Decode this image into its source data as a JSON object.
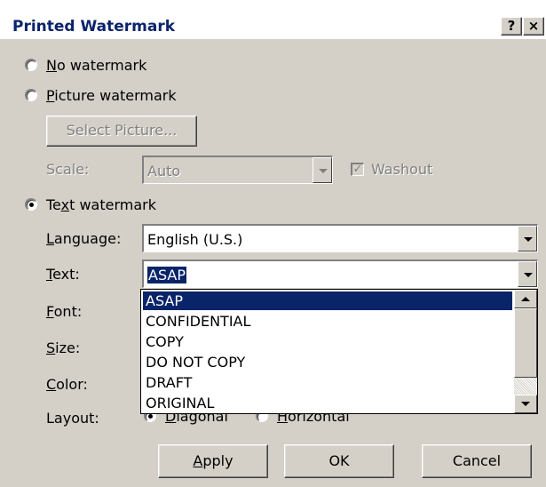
{
  "window": {
    "title": "Printed Watermark",
    "help_label": "?",
    "close_label": "×"
  },
  "options": {
    "no_watermark": {
      "label": "No watermark",
      "selected": false
    },
    "picture_watermark": {
      "label": "Picture watermark",
      "selected": false
    },
    "text_watermark": {
      "label": "Text watermark",
      "selected": true
    }
  },
  "picture": {
    "select_button": "Select Picture...",
    "scale_label": "Scale:",
    "scale_value": "Auto",
    "washout_label": "Washout",
    "washout_checked": true
  },
  "text_fields": {
    "language_label": "Language:",
    "language_value": "English (U.S.)",
    "text_label": "Text:",
    "text_value": "ASAP",
    "font_label": "Font:",
    "size_label": "Size:",
    "color_label": "Color:",
    "layout_label": "Layout:",
    "layout_diagonal": "Diagonal",
    "layout_horizontal": "Horizontal"
  },
  "dropdown": {
    "items": [
      "ASAP",
      "CONFIDENTIAL",
      "COPY",
      "DO NOT COPY",
      "DRAFT",
      "ORIGINAL"
    ],
    "selected_index": 0
  },
  "buttons": {
    "apply": "Apply",
    "ok": "OK",
    "cancel": "Cancel"
  },
  "colors": {
    "dialog_bg": "#d4d0c8",
    "title_text": "#0a246a",
    "selection": "#0a246a"
  }
}
